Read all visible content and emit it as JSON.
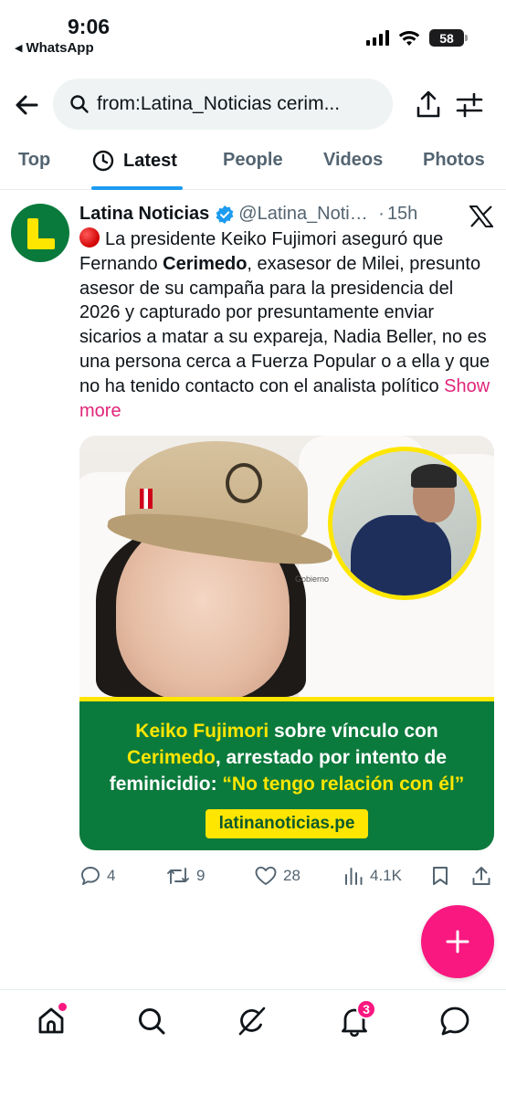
{
  "status_bar": {
    "time": "9:06",
    "back_app": "WhatsApp",
    "battery": "58"
  },
  "search": {
    "query": "from:Latina_Noticias cerim..."
  },
  "tabs": [
    {
      "label": "Top",
      "active": false
    },
    {
      "label": "Latest",
      "active": true
    },
    {
      "label": "People",
      "active": false
    },
    {
      "label": "Videos",
      "active": false
    },
    {
      "label": "Photos",
      "active": false
    }
  ],
  "tweet": {
    "author_name": "Latina Noticias",
    "handle": "@Latina_Notici...",
    "separator": "·",
    "time": "15h",
    "text_1": "La presidente Keiko Fujimori aseguró que Fernando ",
    "text_bold": "Cerimedo",
    "text_2": ", exasesor de Milei, presunto asesor de su campaña para la presidencia del 2026 y capturado por presuntamente enviar sicarios a matar a su expareja, Nadia Beller, no es una persona cerca a Fuerza Popular o a ella y que no ha tenido contacto con el analista político ",
    "show_more": "Show more",
    "media": {
      "cap_label": "Gobierno",
      "headline_y1": "Keiko Fujimori",
      "headline_w1": " sobre vínculo con",
      "headline_y2": "Cerimedo",
      "headline_w2": ", arrestado por intento de",
      "headline_w3": "feminicidio: ",
      "headline_y3": "“No tengo relación con él”",
      "url": "latinanoticias.pe"
    },
    "stats": {
      "replies": "4",
      "reposts": "9",
      "likes": "28",
      "views": "4.1K"
    }
  },
  "nav": {
    "notifications_badge": "3"
  },
  "colors": {
    "accent_blue": "#1d9bf0",
    "link_pink": "#e0247a",
    "fab_pink": "#f91880",
    "brand_green": "#0b7a3d",
    "brand_yellow": "#ffe600"
  },
  "icons": [
    "back-arrow-icon",
    "search-icon",
    "share-icon",
    "filter-icon",
    "clock-icon",
    "verified-icon",
    "x-logo-icon",
    "reply-icon",
    "repost-icon",
    "like-icon",
    "views-icon",
    "bookmark-icon",
    "share-post-icon",
    "compose-icon",
    "home-icon",
    "explore-icon",
    "grok-icon",
    "notifications-icon",
    "messages-icon"
  ]
}
